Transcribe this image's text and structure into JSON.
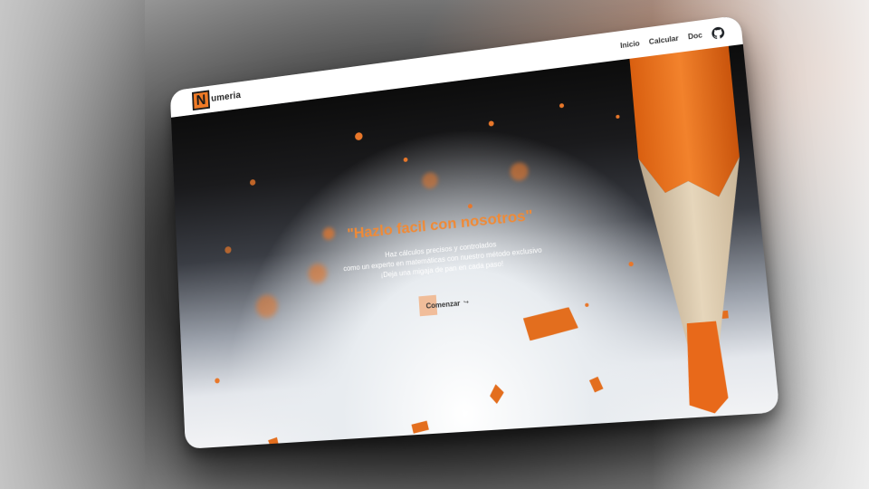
{
  "app": {
    "logo_letter": "N",
    "brand_name": "umeria"
  },
  "nav": {
    "items": [
      {
        "label": "Inicio"
      },
      {
        "label": "Calcular"
      },
      {
        "label": "Doc"
      }
    ],
    "github_icon": "github-icon"
  },
  "hero": {
    "title": "\"Hazlo facil con nosotros\"",
    "lines": [
      "Haz cálculos precisos y controlados",
      "como un experto en matemáticas con nuestro método exclusivo",
      "¡Deja una migaja de pan en cada paso!"
    ],
    "cta_label": "Comenzar",
    "cta_arrow": "↪"
  },
  "colors": {
    "accent": "#ef7a26",
    "title": "#f08a36"
  }
}
